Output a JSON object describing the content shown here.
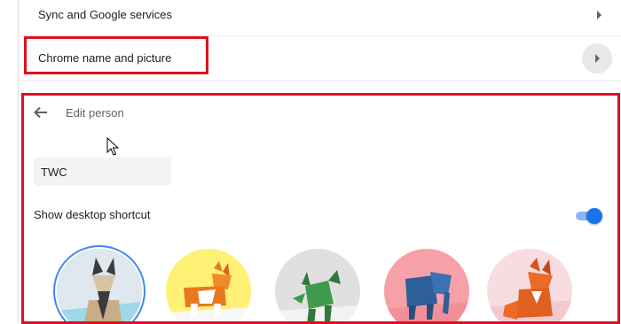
{
  "settings": {
    "sync_row_label": "Sync and Google services",
    "name_row_label": "Chrome name and picture"
  },
  "edit_person": {
    "title": "Edit person",
    "name_value": "TWC",
    "show_desktop_shortcut_label": "Show desktop shortcut",
    "show_desktop_shortcut_enabled": true,
    "avatars": [
      {
        "icon": "origami-cat-icon",
        "background": "#dfe7ef",
        "selected": true
      },
      {
        "icon": "origami-corgi-icon",
        "background": "#fff176",
        "selected": false
      },
      {
        "icon": "origami-dragon-icon",
        "background": "#e0e0e0",
        "selected": false
      },
      {
        "icon": "origami-elephant-icon",
        "background": "#f6a1a8",
        "selected": false
      },
      {
        "icon": "origami-fox-icon",
        "background": "#f8dde0",
        "selected": false
      }
    ]
  },
  "colors": {
    "highlight_red": "#e0101f",
    "toggle_blue": "#1a73e8",
    "selected_ring": "#4285f4"
  }
}
